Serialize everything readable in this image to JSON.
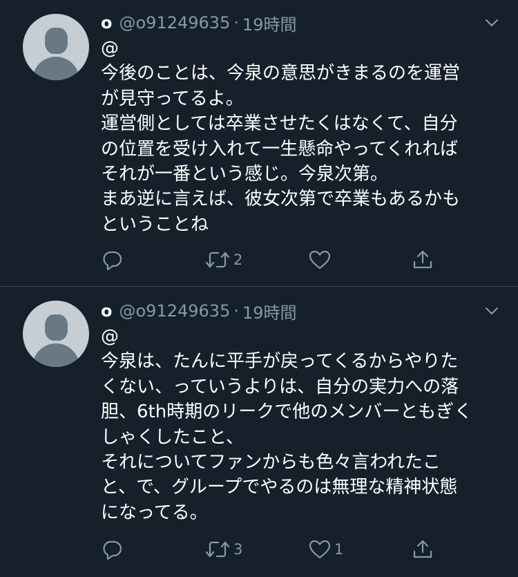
{
  "colors": {
    "background": "#15202b",
    "divider": "#38444d",
    "secondary_text": "#8899a6",
    "avatar_bg": "#c6cdd5",
    "avatar_fg": "#6a7885"
  },
  "tweets": [
    {
      "display_name": "o",
      "handle": "@o91249635",
      "separator": "·",
      "time": "19時間",
      "lines": [
        "@",
        "今後のことは、今泉の意思がきまるのを運営",
        "が見守ってるよ。",
        "運営側としては卒業させたくはなくて、自分",
        "の位置を受け入れて一生懸命やってくれれば",
        "それが一番という感じ。今泉次第。",
        "まあ逆に言えば、彼女次第で卒業もあるかも",
        "ということね"
      ],
      "reply_count": "",
      "retweet_count": "2",
      "like_count": "",
      "icons": [
        "reply-icon",
        "retweet-icon",
        "like-icon",
        "share-icon"
      ]
    },
    {
      "display_name": "o",
      "handle": "@o91249635",
      "separator": "·",
      "time": "19時間",
      "lines": [
        "@",
        "今泉は、たんに平手が戻ってくるからやりた",
        "くない、っていうよりは、自分の実力への落",
        "胆、6th時期のリークで他のメンバーともぎく",
        "しゃくしたこと、",
        "それについてファンからも色々言われたこ",
        "と、で、グループでやるのは無理な精神状態",
        "になってる。"
      ],
      "reply_count": "",
      "retweet_count": "3",
      "like_count": "1",
      "icons": [
        "reply-icon",
        "retweet-icon",
        "like-icon",
        "share-icon"
      ]
    }
  ]
}
